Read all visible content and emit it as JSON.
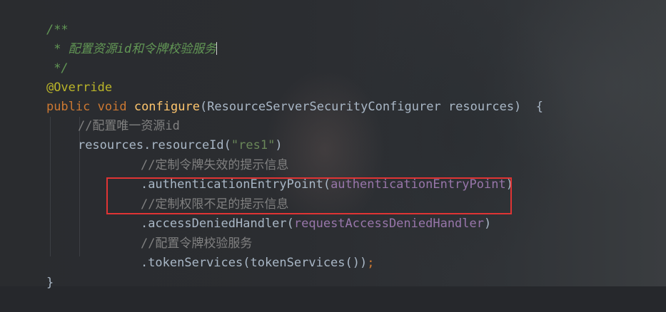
{
  "code": {
    "l1": "/**",
    "l2_star": " * ",
    "l2_text": "配置资源id和令牌校验服务",
    "l3": " */",
    "l4": "@Override",
    "l5": {
      "kw1": "public",
      "kw2": "void",
      "method": "configure",
      "open": "(ResourceServerSecurityConfigurer resources)",
      "brace": "{"
    },
    "l6": "//配置唯一资源id",
    "l7": {
      "prefix": "resources.resourceId(",
      "arg": "\"res1\"",
      "suffix": ")"
    },
    "l8": "//定制令牌失效的提示信息",
    "l9": {
      "prefix": ".authenticationEntryPoint(",
      "arg": "authenticationEntryPoint",
      "suffix": ")"
    },
    "l10": "//定制权限不足的提示信息",
    "l11": {
      "prefix": ".accessDeniedHandler(",
      "arg": "requestAccessDeniedHandler",
      "suffix": ")"
    },
    "l12": "//配置令牌校验服务",
    "l13": {
      "text": ".tokenServices(tokenServices())",
      "semi": ";"
    },
    "l14": "}"
  },
  "colors": {
    "comment_doc": "#629755",
    "comment_line": "#808080",
    "keyword": "#cc7832",
    "annotation": "#bbb529",
    "method": "#ffc66d",
    "string": "#6a8759",
    "field": "#9876aa",
    "text": "#a9b7c6",
    "highlight_border": "#e03434"
  }
}
